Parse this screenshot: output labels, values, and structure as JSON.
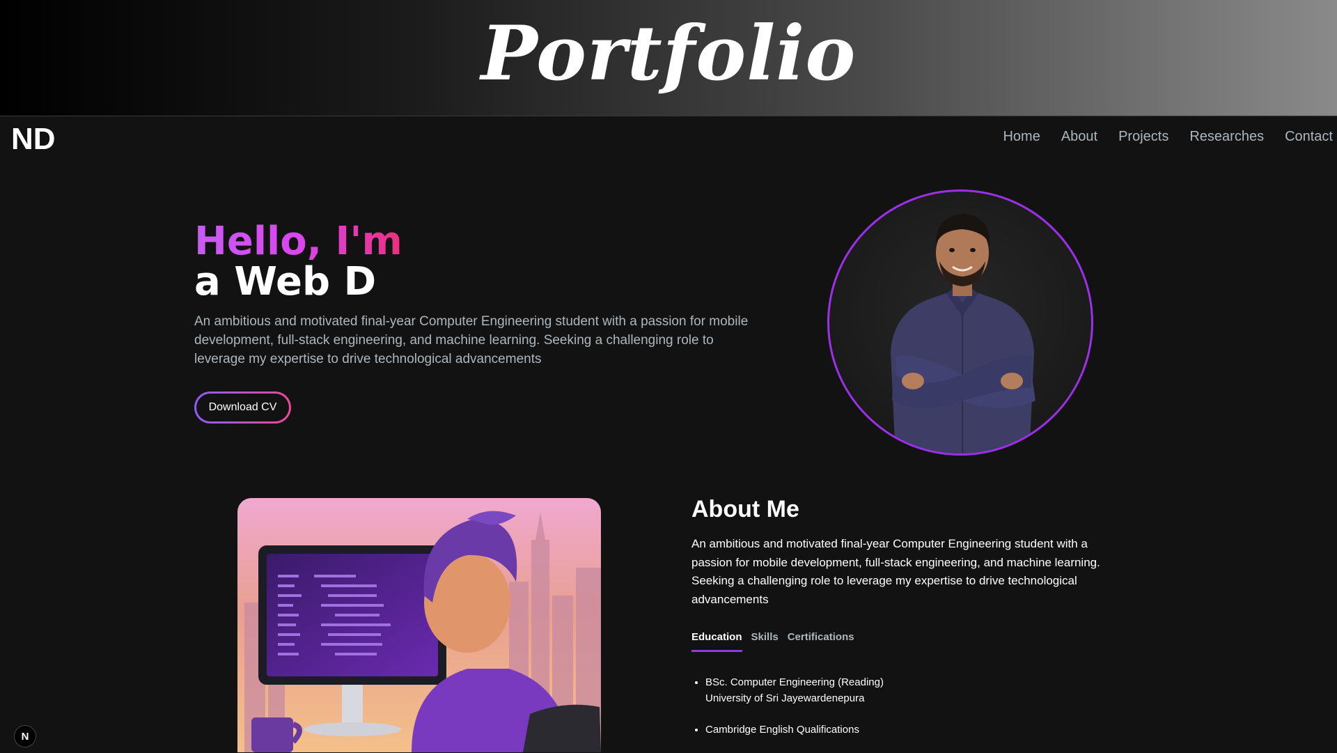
{
  "banner": {
    "title": "Portfolio"
  },
  "navbar": {
    "logo": "ND",
    "links": [
      "Home",
      "About",
      "Projects",
      "Researches",
      "Contact"
    ]
  },
  "hero": {
    "greeting": "Hello, I'm",
    "role": "a Web D",
    "description": "An ambitious and motivated final-year Computer Engineering student with a passion for mobile development, full-stack engineering, and machine learning. Seeking a challenging role to leverage my expertise to drive technological advancements",
    "cv_button": "Download CV"
  },
  "about": {
    "title": "About Me",
    "description": "An ambitious and motivated final-year Computer Engineering student with a passion for mobile development, full-stack engineering, and machine learning. Seeking a challenging role to leverage my expertise to drive technological advancements",
    "tabs": [
      "Education",
      "Skills",
      "Certifications"
    ],
    "active_tab": "Education",
    "education": [
      {
        "line1": "BSc. Computer Engineering (Reading)",
        "line2": "University of Sri Jayewardenepura"
      },
      {
        "line1": "Cambridge English Qualifications",
        "line2": ""
      }
    ]
  },
  "dev_badge": {
    "label": "N"
  },
  "colors": {
    "accent_purple": "#9b30e8",
    "accent_pink": "#ec4899",
    "background": "#121212",
    "muted_text": "#adb7be"
  }
}
